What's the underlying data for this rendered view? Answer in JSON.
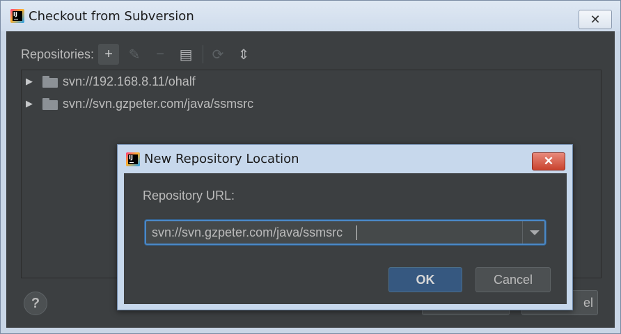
{
  "window": {
    "title": "Checkout from Subversion",
    "close_glyph": "✕"
  },
  "toolbar": {
    "label": "Repositories:",
    "buttons": [
      {
        "icon": "add-icon",
        "glyph": "+"
      },
      {
        "icon": "edit-icon",
        "glyph": "✎"
      },
      {
        "icon": "remove-icon",
        "glyph": "−"
      },
      {
        "icon": "browse-icon",
        "glyph": "▤"
      },
      {
        "icon": "refresh-icon",
        "glyph": "⟳"
      },
      {
        "icon": "collapse-icon",
        "glyph": "⇕"
      }
    ]
  },
  "repositories": [
    {
      "label": "svn://192.168.8.11/ohalf"
    },
    {
      "label": "svn://svn.gzpeter.com/java/ssmsrc"
    }
  ],
  "background_buttons": {
    "help_glyph": "?",
    "right_partial_label": "el"
  },
  "dialog": {
    "title": "New Repository Location",
    "close_glyph": "✕",
    "url_label": "Repository URL:",
    "url_value": "svn://svn.gzpeter.com/java/ssmsrc",
    "ok_label": "OK",
    "cancel_label": "Cancel"
  },
  "colors": {
    "accent": "#4a88c7",
    "ok_button": "#365880",
    "dark_bg": "#3c3f41",
    "close_red": "#c9432e"
  }
}
